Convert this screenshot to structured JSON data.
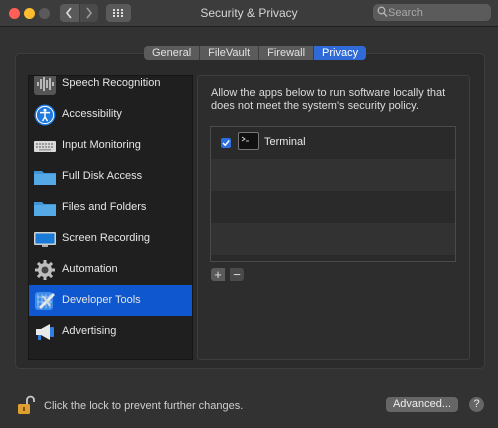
{
  "window": {
    "title": "Security & Privacy",
    "search_placeholder": "Search"
  },
  "tabs": [
    {
      "label": "General"
    },
    {
      "label": "FileVault"
    },
    {
      "label": "Firewall"
    },
    {
      "label": "Privacy",
      "active": true
    }
  ],
  "sidebar": {
    "items": [
      {
        "label": "Speech Recognition",
        "icon": "waveform-icon"
      },
      {
        "label": "Accessibility",
        "icon": "accessibility-icon"
      },
      {
        "label": "Input Monitoring",
        "icon": "keyboard-icon"
      },
      {
        "label": "Full Disk Access",
        "icon": "folder-icon"
      },
      {
        "label": "Files and Folders",
        "icon": "folder-icon"
      },
      {
        "label": "Screen Recording",
        "icon": "display-icon"
      },
      {
        "label": "Automation",
        "icon": "gear-icon"
      },
      {
        "label": "Developer Tools",
        "icon": "developer-tools-icon",
        "selected": true
      },
      {
        "label": "Advertising",
        "icon": "megaphone-icon"
      }
    ]
  },
  "content": {
    "description": "Allow the apps below to run software locally that does not meet the system's security policy.",
    "apps": [
      {
        "name": "Terminal",
        "checked": true,
        "icon": "terminal-icon"
      }
    ],
    "add_label": "+",
    "remove_label": "−"
  },
  "footer": {
    "lock_text": "Click the lock to prevent further changes.",
    "advanced_label": "Advanced...",
    "help_label": "?"
  },
  "colors": {
    "accent": "#0e57cf",
    "tab_active": "#2f6ad6"
  }
}
